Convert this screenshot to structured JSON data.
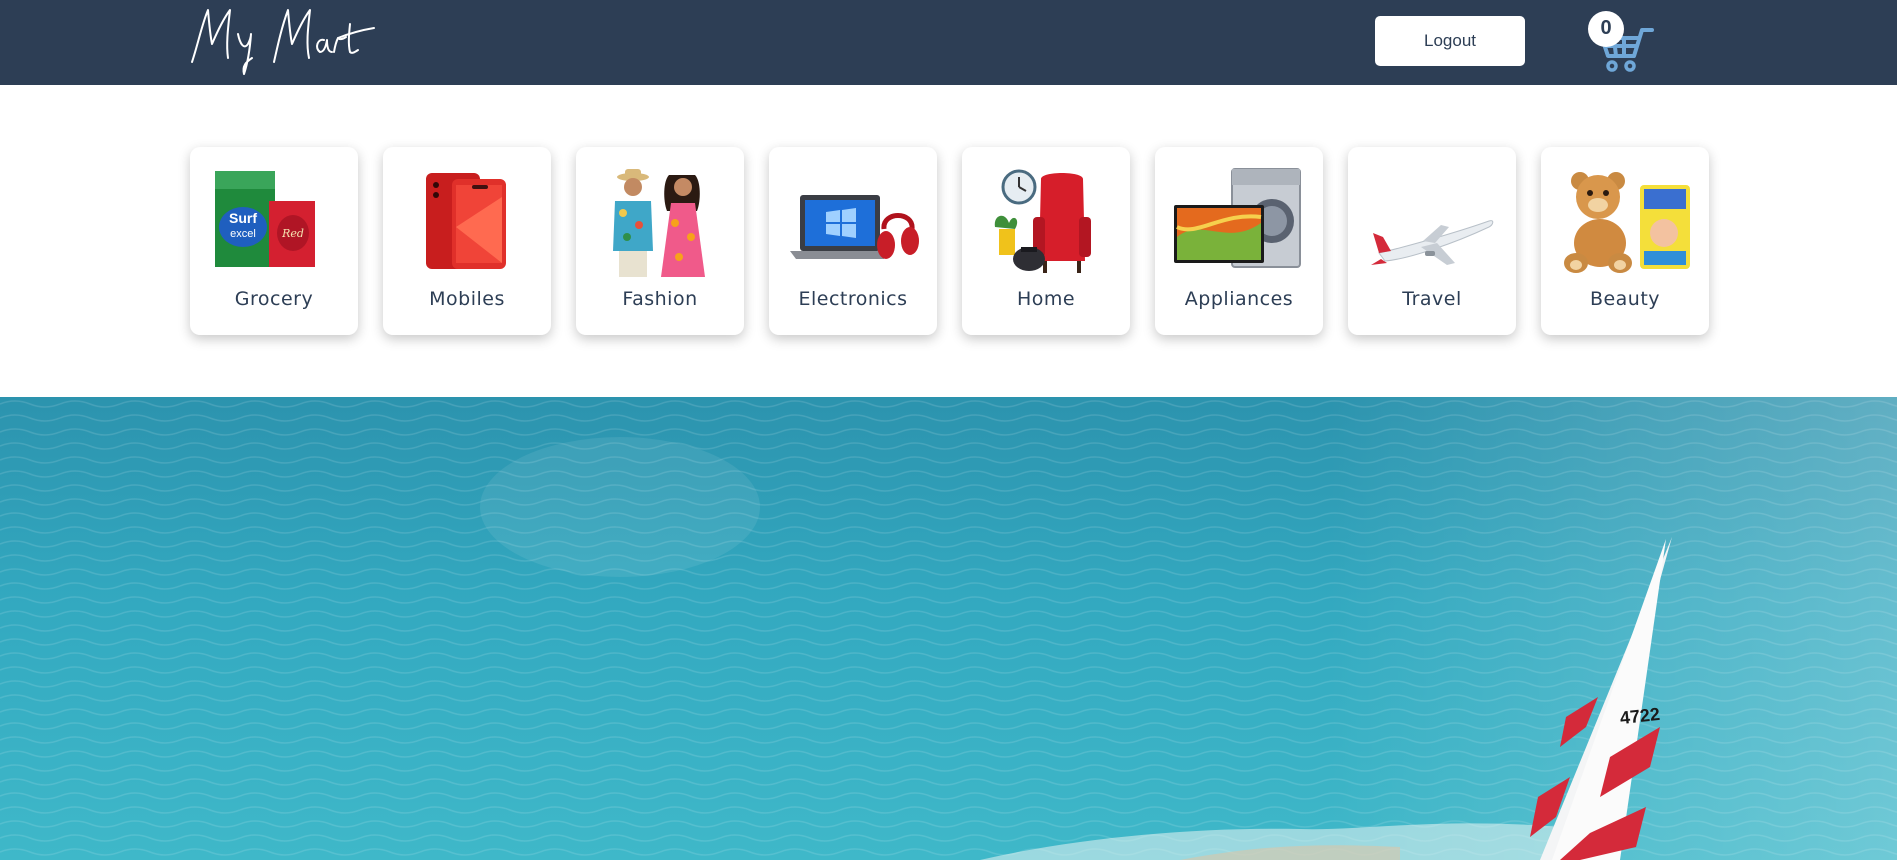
{
  "navbar": {
    "logo_text": "My Mart",
    "logout_label": "Logout",
    "cart_count": "0",
    "background": "#2d3e55"
  },
  "categories": [
    {
      "label": "Grocery",
      "icon": "grocery-products-image"
    },
    {
      "label": "Mobiles",
      "icon": "mobile-phone-image"
    },
    {
      "label": "Fashion",
      "icon": "fashion-models-image"
    },
    {
      "label": "Electronics",
      "icon": "laptop-headphones-image"
    },
    {
      "label": "Home",
      "icon": "home-furniture-image"
    },
    {
      "label": "Appliances",
      "icon": "tv-washing-machine-image"
    },
    {
      "label": "Travel",
      "icon": "airplane-image"
    },
    {
      "label": "Beauty",
      "icon": "teddy-bear-diapers-image"
    }
  ],
  "hero": {
    "sail_number": "4722",
    "colors": {
      "sea": "#2fa6bd",
      "sail_red": "#d42a3a"
    }
  }
}
